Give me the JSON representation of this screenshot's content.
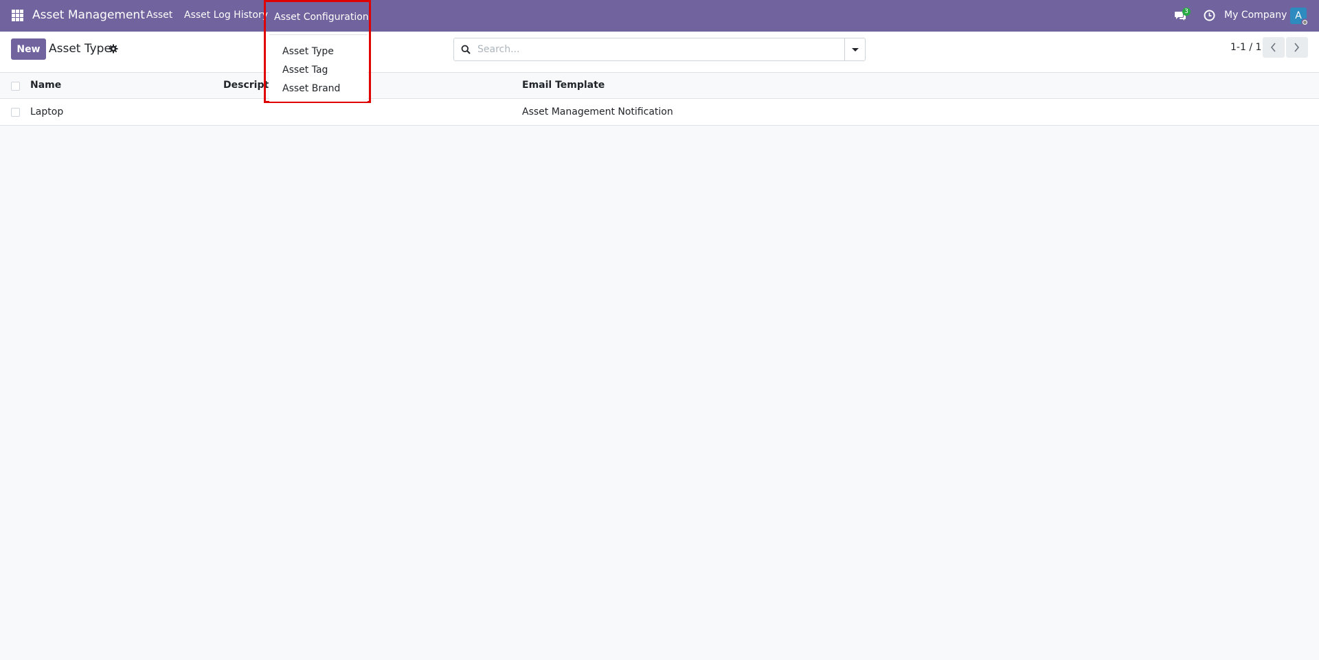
{
  "navbar": {
    "brand": "Asset Management",
    "menu": [
      "Asset",
      "Asset Log History",
      "Asset Configuration"
    ],
    "chat_count": "3",
    "company": "My Company",
    "avatar_letter": "A",
    "background": "#71639e"
  },
  "dropdown": {
    "items": [
      "Asset Type",
      "Asset Tag",
      "Asset Brand"
    ],
    "highlight_color": "#e00000"
  },
  "control_panel": {
    "new_label": "New",
    "title": "Asset Type",
    "search_placeholder": "Search...",
    "pager": "1-1 / 1"
  },
  "table": {
    "columns": [
      "Name",
      "Description",
      "Email Template"
    ],
    "rows": [
      {
        "name": "Laptop",
        "description": "",
        "email_template": "Asset Management Notification"
      }
    ]
  },
  "icons": [
    "apps-grid-icon",
    "chat-icon",
    "clock-icon",
    "gear-icon",
    "search-icon",
    "chevron-left-icon",
    "chevron-right-icon"
  ]
}
